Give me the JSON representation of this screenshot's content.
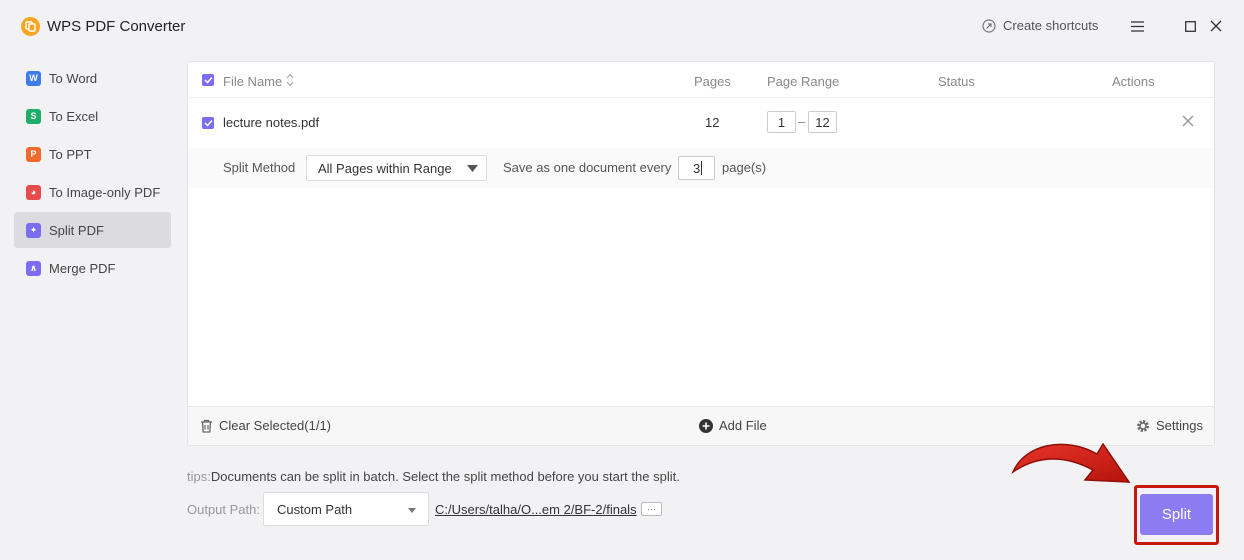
{
  "app": {
    "title": "WPS PDF Converter",
    "create_shortcuts": "Create shortcuts"
  },
  "sidebar": {
    "items": [
      {
        "label": "To Word",
        "icon": "word-icon",
        "glyph": "W",
        "color": "#3e7ce8"
      },
      {
        "label": "To Excel",
        "icon": "excel-icon",
        "glyph": "S",
        "color": "#1fae6a"
      },
      {
        "label": "To PPT",
        "icon": "ppt-icon",
        "glyph": "P",
        "color": "#f06a2d"
      },
      {
        "label": "To Image-only PDF",
        "icon": "image-pdf-icon",
        "glyph": "◕",
        "color": "#e84b4b"
      },
      {
        "label": "Split PDF",
        "icon": "split-icon",
        "glyph": "✦",
        "color": "#7c6cf0"
      },
      {
        "label": "Merge PDF",
        "icon": "merge-icon",
        "glyph": "∧",
        "color": "#7c6cf0"
      }
    ]
  },
  "table": {
    "headers": {
      "file_name": "File Name",
      "pages": "Pages",
      "page_range": "Page Range",
      "status": "Status",
      "actions": "Actions"
    },
    "row": {
      "file_name": "lecture notes.pdf",
      "pages": "12",
      "range_from": "1",
      "range_dash": "–",
      "range_to": "12"
    },
    "split": {
      "method_label": "Split Method",
      "method_value": "All Pages within Range",
      "every_label": "Save as one document every",
      "every_value": "3",
      "unit": "page(s)"
    }
  },
  "footer": {
    "clear_selected": "Clear Selected(1/1)",
    "add_file": "Add File",
    "settings": "Settings"
  },
  "tips": {
    "label": "tips:",
    "text": "Documents can be split in batch. Select the split method before you start the split."
  },
  "output": {
    "label": "Output Path:",
    "mode": "Custom Path",
    "path": "C:/Users/talha/O...em 2/BF-2/finals",
    "more": "···"
  },
  "split_button": "Split",
  "colors": {
    "accent": "#7c6cf0",
    "button": "#8c7cf2",
    "highlight": "#c8180e"
  }
}
